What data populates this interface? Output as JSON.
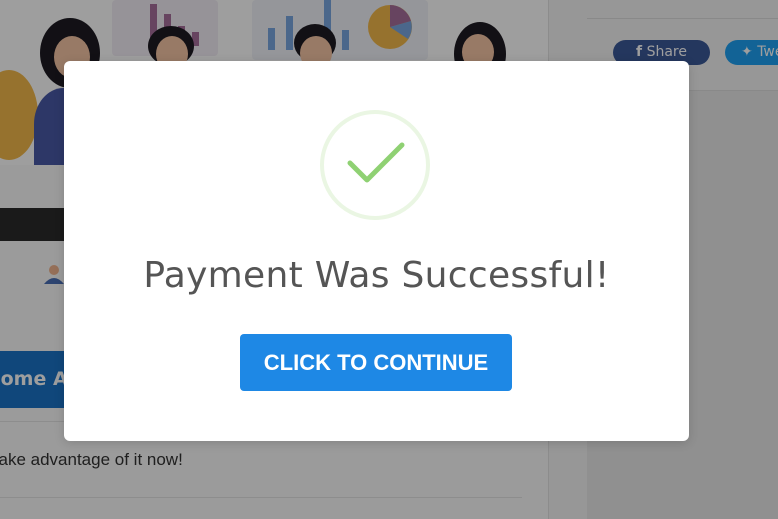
{
  "background": {
    "member_button_label": "Become A Member",
    "content_text": "Take advantage of it now!",
    "share_facebook_label": "Share",
    "share_twitter_label": "Tweet",
    "colors": {
      "member_button": "#1a73c7",
      "facebook": "#3b5998",
      "twitter": "#1da1f2",
      "dark_strip": "#2a2a2a"
    }
  },
  "modal": {
    "title": "Payment Was Successful!",
    "button_label": "CLICK TO CONTINUE",
    "icon": "checkmark-icon",
    "colors": {
      "check": "#8fd173",
      "ring": "#eaf6e3",
      "button": "#1e88e5",
      "title": "#555555"
    }
  }
}
